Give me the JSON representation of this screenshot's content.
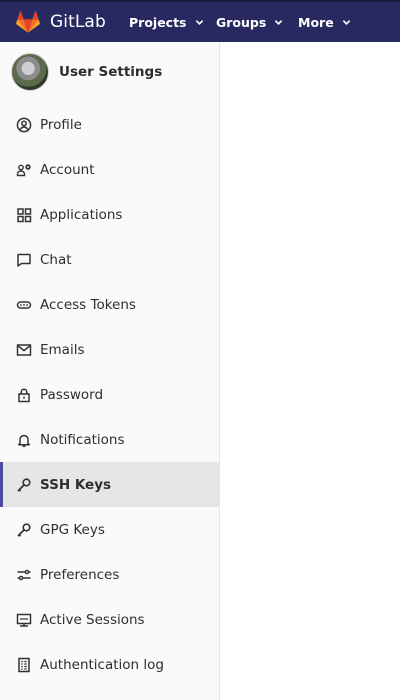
{
  "topbar": {
    "brand": "GitLab",
    "nav": [
      {
        "label": "Projects"
      },
      {
        "label": "Groups"
      },
      {
        "label": "More"
      }
    ]
  },
  "sidebar": {
    "title": "User Settings",
    "items": [
      {
        "label": "Profile",
        "icon": "profile-icon"
      },
      {
        "label": "Account",
        "icon": "account-icon"
      },
      {
        "label": "Applications",
        "icon": "applications-icon"
      },
      {
        "label": "Chat",
        "icon": "chat-icon"
      },
      {
        "label": "Access Tokens",
        "icon": "access-tokens-icon"
      },
      {
        "label": "Emails",
        "icon": "emails-icon"
      },
      {
        "label": "Password",
        "icon": "password-icon"
      },
      {
        "label": "Notifications",
        "icon": "notifications-icon"
      },
      {
        "label": "SSH Keys",
        "icon": "ssh-key-icon",
        "active": true
      },
      {
        "label": "GPG Keys",
        "icon": "gpg-key-icon"
      },
      {
        "label": "Preferences",
        "icon": "preferences-icon"
      },
      {
        "label": "Active Sessions",
        "icon": "active-sessions-icon"
      },
      {
        "label": "Authentication log",
        "icon": "authentication-log-icon"
      }
    ]
  },
  "colors": {
    "topbar": "#292961",
    "sidebar": "#fafafa",
    "active_indicator": "#4b4ba3",
    "active_bg": "#e6e6e6"
  }
}
